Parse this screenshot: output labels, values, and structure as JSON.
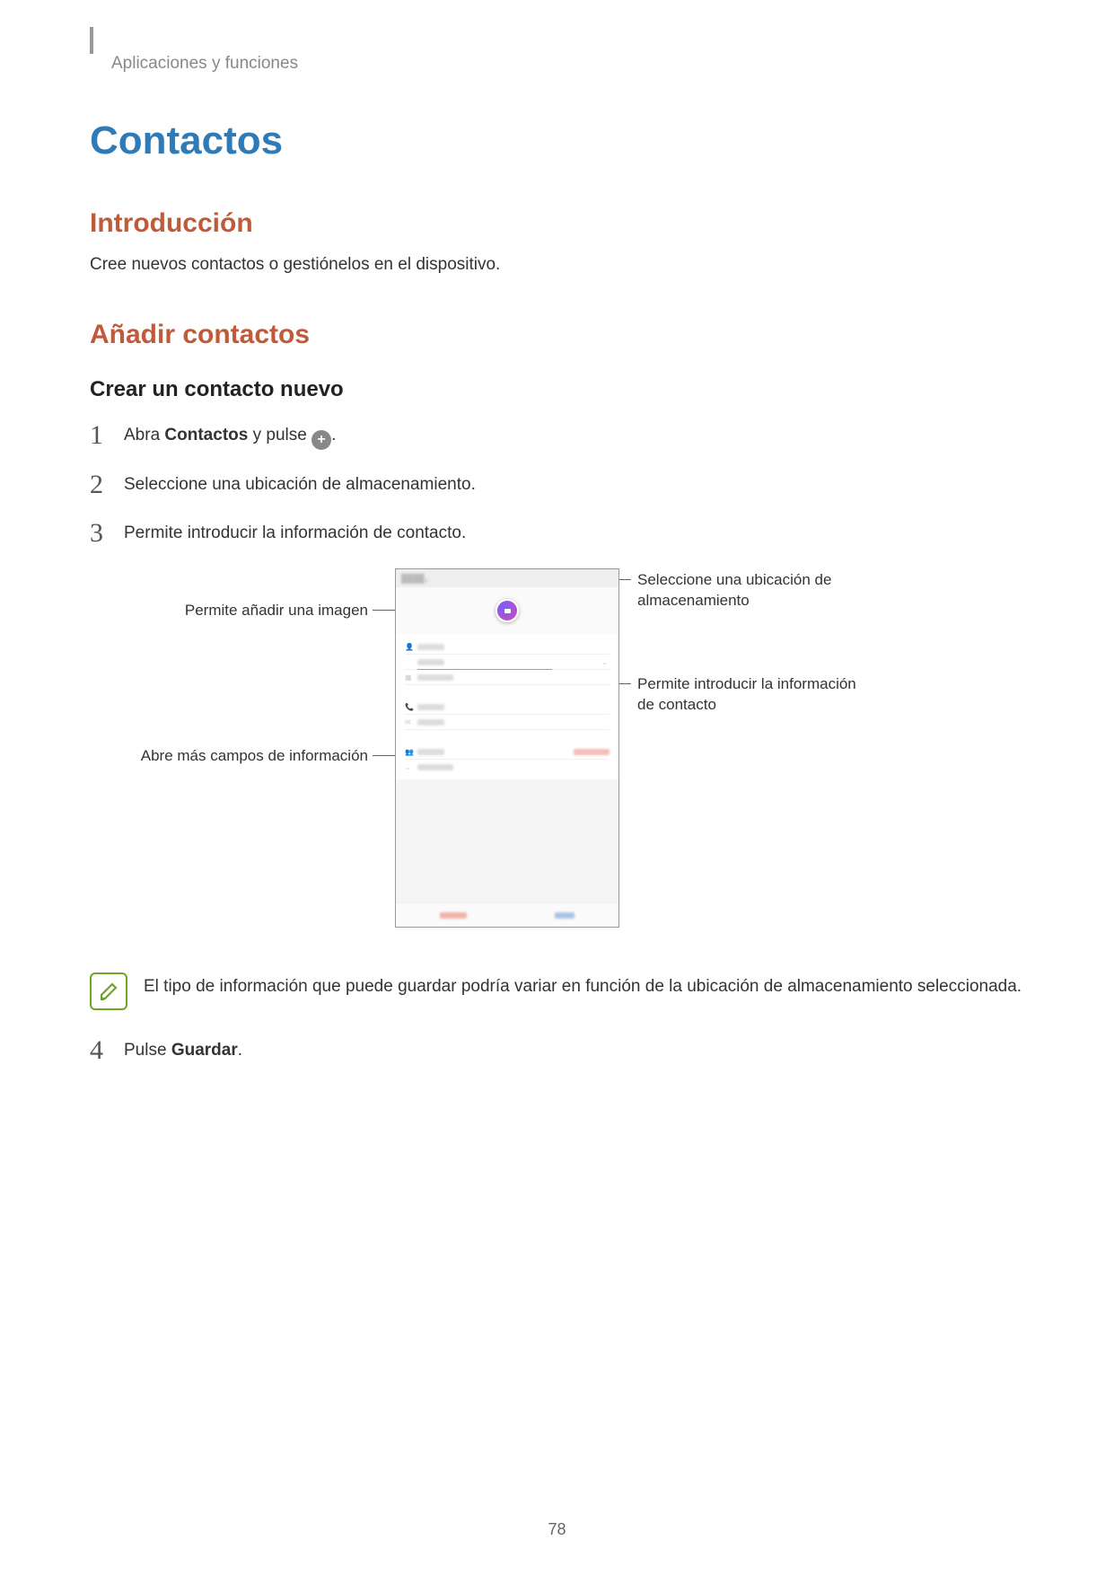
{
  "breadcrumb": "Aplicaciones y funciones",
  "title": "Contactos",
  "section_intro": {
    "heading": "Introducción",
    "text": "Cree nuevos contactos o gestiónelos en el dispositivo."
  },
  "section_add": {
    "heading": "Añadir contactos",
    "sub_heading": "Crear un contacto nuevo",
    "steps": [
      {
        "num": "1",
        "pre": "Abra ",
        "bold": "Contactos",
        "post": " y pulse ",
        "has_icon": true,
        "end": "."
      },
      {
        "num": "2",
        "pre": "Seleccione una ubicación de almacenamiento.",
        "bold": "",
        "post": "",
        "has_icon": false,
        "end": ""
      },
      {
        "num": "3",
        "pre": "Permite introducir la información de contacto.",
        "bold": "",
        "post": "",
        "has_icon": false,
        "end": ""
      }
    ],
    "step4": {
      "num": "4",
      "pre": "Pulse ",
      "bold": "Guardar",
      "post": "."
    }
  },
  "callouts": {
    "left_image": "Permite añadir una imagen",
    "left_more": "Abre más campos de información",
    "right_storage": "Seleccione una ubicación de almacenamiento",
    "right_info": "Permite introducir la información de contacto"
  },
  "note_text": "El tipo de información que puede guardar podría variar en función de la ubicación de almacenamiento seleccionada.",
  "page_number": "78"
}
